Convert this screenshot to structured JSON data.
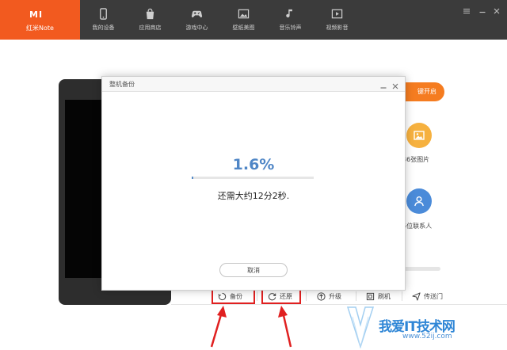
{
  "brand": {
    "logo_text": "MI",
    "model": "红米Note"
  },
  "nav": {
    "items": [
      {
        "label": "我的设备",
        "icon": "phone-icon"
      },
      {
        "label": "应用商店",
        "icon": "shopping-bag-icon"
      },
      {
        "label": "游戏中心",
        "icon": "gamepad-icon"
      },
      {
        "label": "壁纸美图",
        "icon": "picture-icon"
      },
      {
        "label": "音乐铃声",
        "icon": "music-note-icon"
      },
      {
        "label": "视频影音",
        "icon": "video-icon"
      }
    ]
  },
  "side": {
    "oneclick_label": "键开启",
    "photos_text": "86张图片",
    "contacts_text": "6位联系人"
  },
  "actions": {
    "backup": "备份",
    "restore": "还原",
    "upgrade": "升级",
    "flash": "刷机",
    "transfer": "传送门"
  },
  "dialog": {
    "title": "整机备份",
    "percent_text": "1.6%",
    "progress": 0.016,
    "remaining_text": "还需大约12分2秒.",
    "cancel_label": "取消"
  },
  "watermark": {
    "text": "我爱IT技术网",
    "url": "www.52ij.com"
  },
  "colors": {
    "brand": "#f25a1f",
    "topbar": "#3b3b3b",
    "accent_blue": "#4f86c6",
    "highlight_red": "#e02020",
    "orange": "#f57c20"
  }
}
